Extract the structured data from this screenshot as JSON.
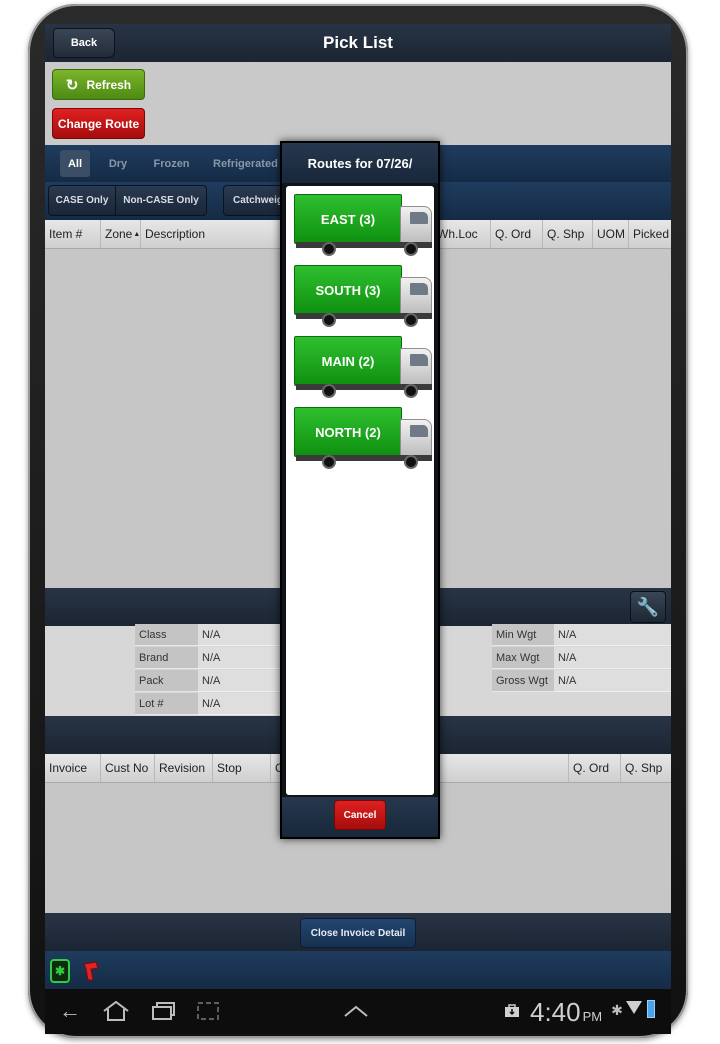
{
  "header": {
    "title": "Pick List",
    "back_label": "Back"
  },
  "actions": {
    "refresh_label": "Refresh",
    "change_route_label": "Change Route"
  },
  "filters": [
    {
      "label": "All",
      "active": true
    },
    {
      "label": "Dry"
    },
    {
      "label": "Frozen"
    },
    {
      "label": "Refrigerated"
    }
  ],
  "segments": {
    "case_only": "CASE Only",
    "non_case_only": "Non-CASE Only",
    "catchweight": "Catchweig"
  },
  "pick_columns": [
    "Item #",
    "Zone",
    "Description",
    "Wh.Loc",
    "Q. Ord",
    "Q. Shp",
    "UOM",
    "Picked"
  ],
  "details": {
    "left": [
      {
        "label": "Class",
        "value": "N/A"
      },
      {
        "label": "Brand",
        "value": "N/A"
      },
      {
        "label": "Pack",
        "value": "N/A"
      },
      {
        "label": "Lot #",
        "value": "N/A"
      }
    ],
    "right": [
      {
        "label": "Min Wgt",
        "value": "N/A"
      },
      {
        "label": "Max Wgt",
        "value": "N/A"
      },
      {
        "label": "Gross Wgt",
        "value": "N/A"
      }
    ]
  },
  "invoice_columns": [
    "Invoice",
    "Cust No",
    "Revision",
    "Stop",
    "C",
    "Q. Ord",
    "Q. Shp"
  ],
  "close_invoice_label": "Close Invoice Detail",
  "routes_dialog": {
    "title": "Routes for 07/26/",
    "routes": [
      "EAST (3)",
      "SOUTH (3)",
      "MAIN (2)",
      "NORTH (2)"
    ],
    "cancel_label": "Cancel"
  },
  "system_bar": {
    "time": "4:40",
    "ampm": "PM"
  },
  "colors": {
    "route_green": "#1aa61a",
    "danger_red": "#c41414",
    "action_green": "#5e9b1c",
    "navy": "#1b2533"
  }
}
